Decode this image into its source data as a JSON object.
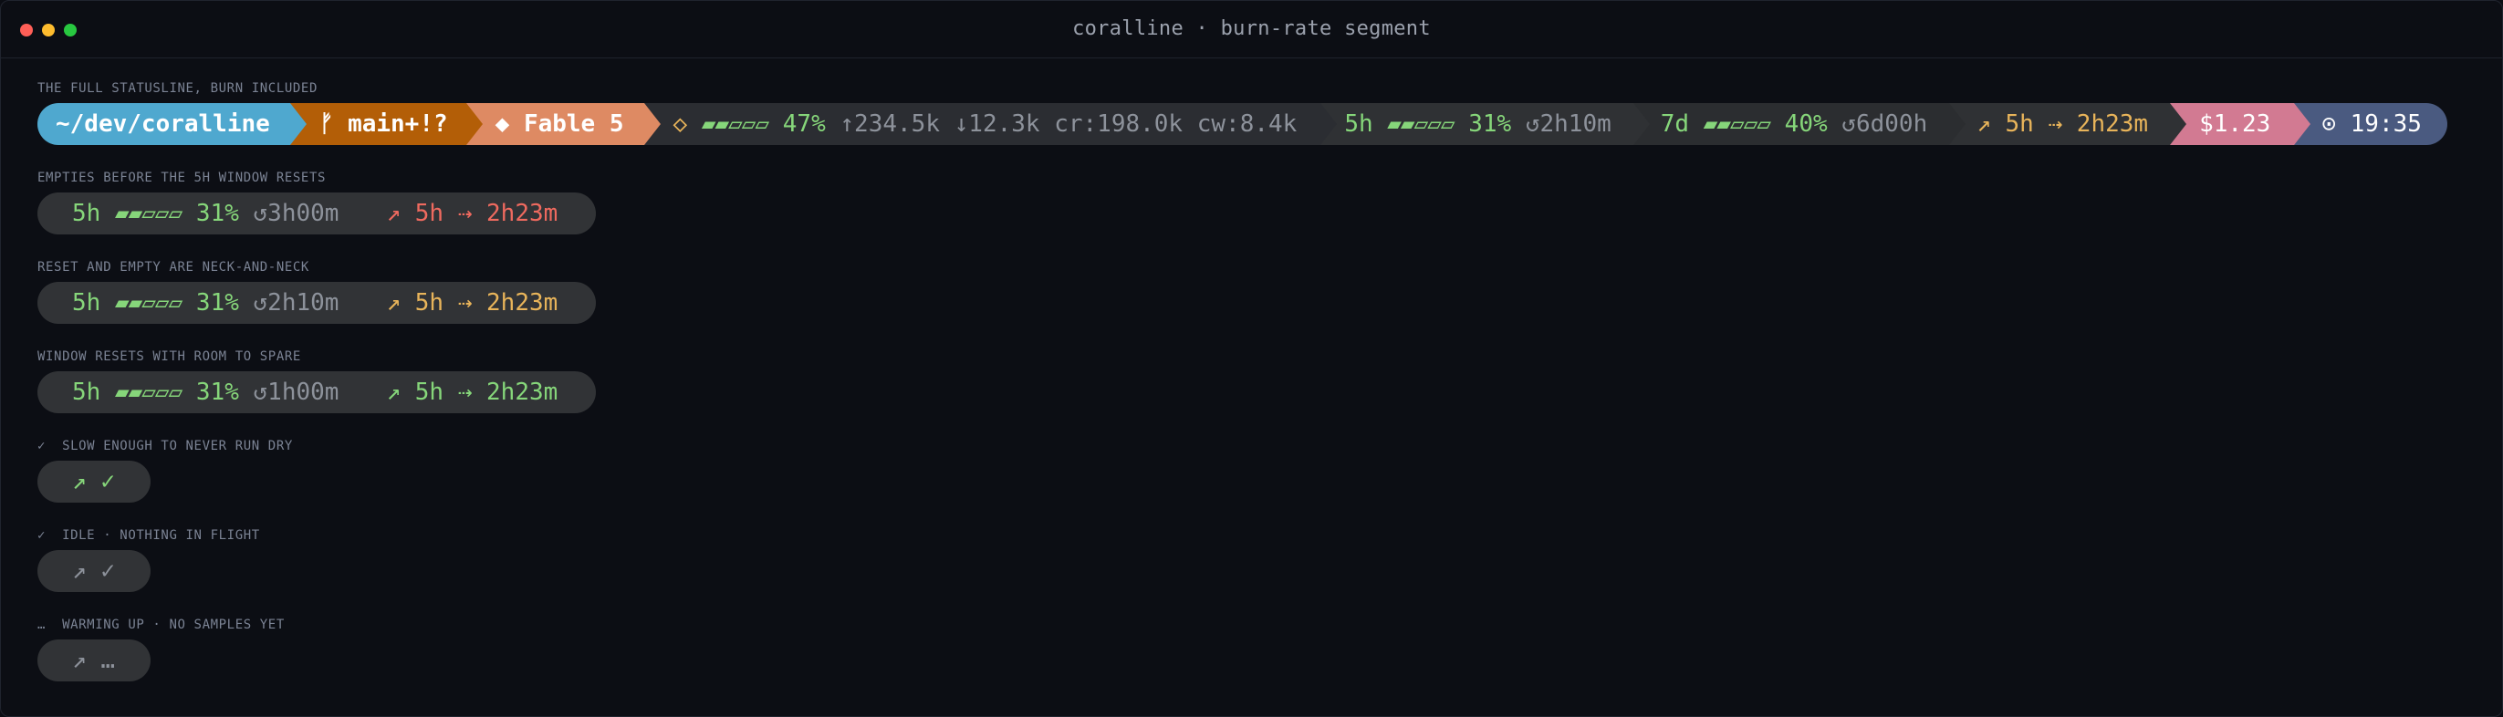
{
  "window": {
    "title": "coralline · burn-rate segment"
  },
  "sections": {
    "full_label": "THE FULL STATUSLINE, BURN INCLUDED",
    "empties_label": "EMPTIES BEFORE THE 5H WINDOW RESETS",
    "neck_label": "RESET AND EMPTY ARE NECK-AND-NECK",
    "spare_label": "WINDOW RESETS WITH ROOM TO SPARE",
    "slow_label": "✓  SLOW ENOUGH TO NEVER RUN DRY",
    "idle_label": "✓  IDLE · NOTHING IN FLIGHT",
    "warming_label": "…  WARMING UP · NO SAMPLES YET"
  },
  "statusline": {
    "cwd": "~/dev/coralline",
    "git": "ᚠ main+!?",
    "model": "◆ Fable 5",
    "context": {
      "icon": "◇",
      "bars": "▰▰▱▱▱",
      "percent": "47%",
      "tokens": "↑234.5k ↓12.3k cr:198.0k cw:8.4k"
    },
    "five_hour": {
      "label": "5h",
      "bars": "▰▰▱▱▱",
      "percent": "31%",
      "reset": "↺2h10m"
    },
    "seven_day": {
      "label": "7d",
      "bars": "▰▰▱▱▱",
      "percent": "40%",
      "reset": "↺6d00h"
    },
    "burn": "↗ 5h ⇢ 2h23m",
    "cost": "$1.23",
    "time": "⊙ 19:35"
  },
  "examples": {
    "empties": {
      "label": "5h",
      "bars": "▰▰▱▱▱",
      "percent": "31%",
      "reset": "↺3h00m",
      "burn": "↗ 5h ⇢ 2h23m"
    },
    "neck": {
      "label": "5h",
      "bars": "▰▰▱▱▱",
      "percent": "31%",
      "reset": "↺2h10m",
      "burn": "↗ 5h ⇢ 2h23m"
    },
    "spare": {
      "label": "5h",
      "bars": "▰▰▱▱▱",
      "percent": "31%",
      "reset": "↺1h00m",
      "burn": "↗ 5h ⇢ 2h23m"
    },
    "slow": {
      "arrow": "↗",
      "status": "✓"
    },
    "idle": {
      "arrow": "↗",
      "status": "✓"
    },
    "warming": {
      "arrow": "↗",
      "status": "…"
    }
  },
  "colors": {
    "green": "#86d67a",
    "amber": "#e8b45a",
    "red": "#ef6a5f",
    "cwd_bg": "#4fa8cf",
    "git_bg": "#b35e07",
    "model_bg": "#de8a63",
    "cost_bg": "#d27a92",
    "time_bg": "#4a5a80"
  }
}
